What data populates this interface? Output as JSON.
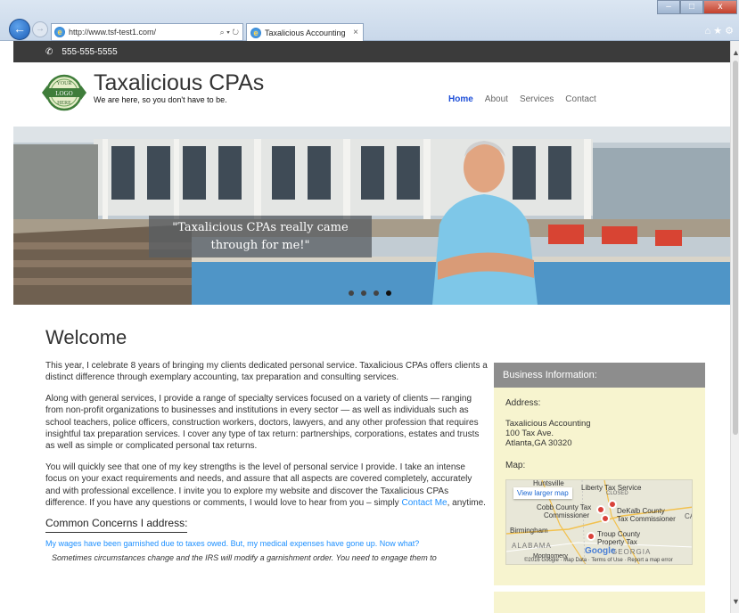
{
  "browser": {
    "url": "http://www.tsf-test1.com/",
    "address_controls": "⌕ ▾ ↻",
    "tab_title": "Taxalicious Accounting",
    "tab_close": "×",
    "win_min": "–",
    "win_max": "□",
    "win_close": "x",
    "right_icons": "⌂ ★ ⚙"
  },
  "topbar": {
    "phone": "555-555-5555"
  },
  "site": {
    "title": "Taxalicious CPAs",
    "tagline": "We are here, so you don't have to be.",
    "logo_lines": [
      "YOUR",
      "LOGO",
      "HERE"
    ]
  },
  "nav": {
    "items": [
      "Home",
      "About",
      "Services",
      "Contact"
    ]
  },
  "hero": {
    "quote_line1": "\"Taxalicious CPAs really came",
    "quote_line2": "through for me!\""
  },
  "welcome": {
    "heading": "Welcome"
  },
  "content": {
    "p1": "This year, I celebrate 8 years of bringing my clients dedicated personal service. Taxalicious CPAs offers clients a distinct difference through exemplary accounting, tax preparation and consulting services.",
    "p2": "Along with general services, I provide a range of specialty services focused on a variety of clients — ranging from non-profit organizations to businesses and institutions in every sector — as well as individuals such as school teachers, police officers, construction workers, doctors, lawyers, and any other profession that requires insightful tax preparation services. I cover any type of tax return: partnerships, corporations, estates and trusts as well as simple or complicated personal tax returns.",
    "p3_start": "You will quickly see that one of my key strengths is the level of personal service I provide. I take an intense focus on your exact requirements and needs, and assure that all aspects are covered completely, accurately and with professional excellence. I invite you to explore my website and discover the Taxalicious CPAs difference. If you have any questions or comments, I would love to hear from you – simply ",
    "p3_link": "Contact Me",
    "p3_end": ", anytime.",
    "concerns_heading": "Common Concerns I address:",
    "concern1_link": "My wages have been garnished due to taxes owed. But, my medical expenses have gone up. Now what?",
    "concern1_body": "Sometimes circumstances change and the IRS will modify a garnishment order. You need to engage them to"
  },
  "sidebar": {
    "heading": "Business Information:",
    "address_label": "Address:",
    "address_lines": [
      "Taxalicious Accounting",
      "100 Tax Ave.",
      "Atlanta,GA 30320"
    ],
    "map_label": "Map:",
    "map": {
      "view_larger": "View larger map",
      "labels": [
        "Huntsville",
        "Liberty Tax Service",
        "CLOSED",
        "Cobb County Tax",
        "Commissioner",
        "DeKalb County",
        "Tax Commissioner",
        "Birmingham",
        "Troup County",
        "Property Tax",
        "ALABAMA",
        "GEORGIA",
        "Montgomery",
        "Google",
        "CA"
      ],
      "footer": "©2016 Google · Map Data · Terms of Use · Report a map error"
    }
  },
  "colors": {
    "accent": "#1e4fd8",
    "link": "#1e90ff",
    "sidebar_bg": "#f7f4cf",
    "topbar": "#3b3b3b"
  }
}
